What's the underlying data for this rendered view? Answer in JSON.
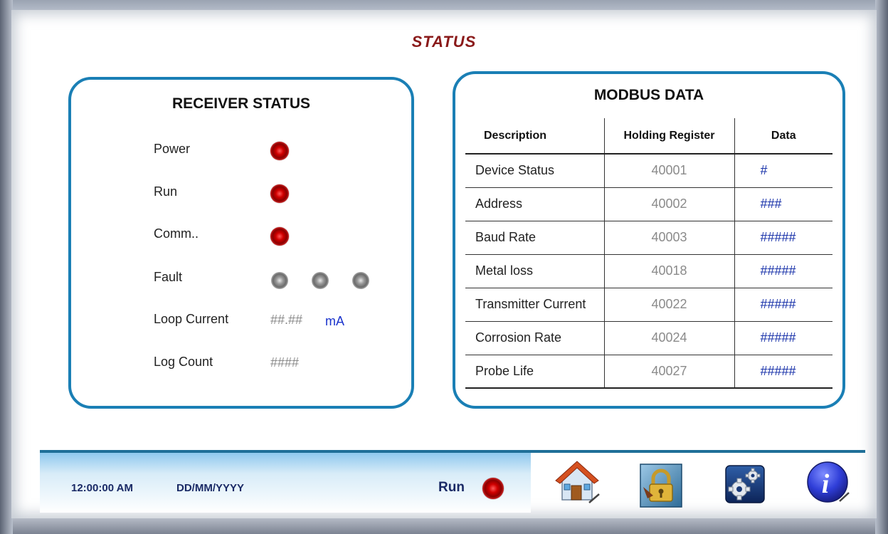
{
  "page_title": "STATUS",
  "receiver_status": {
    "heading": "RECEIVER STATUS",
    "rows": {
      "power": {
        "label": "Power",
        "indicator": "red"
      },
      "run": {
        "label": "Run",
        "indicator": "red"
      },
      "comm": {
        "label": "Comm..",
        "indicator": "red"
      },
      "fault": {
        "label": "Fault",
        "indicators": [
          "grey",
          "grey",
          "grey"
        ]
      },
      "loop_current": {
        "label": "Loop Current",
        "value": "##.##",
        "unit": "mA"
      },
      "log_count": {
        "label": "Log Count",
        "value": "####"
      }
    }
  },
  "modbus": {
    "heading": "MODBUS DATA",
    "columns": [
      "Description",
      "Holding Register",
      "Data"
    ],
    "rows": [
      {
        "description": "Device Status",
        "register": "40001",
        "data": "#"
      },
      {
        "description": "Address",
        "register": "40002",
        "data": "###"
      },
      {
        "description": "Baud Rate",
        "register": "40003",
        "data": "#####"
      },
      {
        "description": "Metal loss",
        "register": "40018",
        "data": "#####"
      },
      {
        "description": "Transmitter Current",
        "register": "40022",
        "data": "#####"
      },
      {
        "description": "Corrosion Rate",
        "register": "40024",
        "data": "#####"
      },
      {
        "description": "Probe Life",
        "register": "40027",
        "data": "#####"
      }
    ]
  },
  "footer": {
    "time": "12:00:00 AM",
    "date": "DD/MM/YYYY",
    "run_label": "Run",
    "run_indicator": "red",
    "buttons": [
      "home-icon",
      "lock-icon",
      "settings-gear-icon",
      "info-icon"
    ]
  },
  "colors": {
    "accent_border": "#1a7fb5",
    "title": "#8a1a1a",
    "led_on": "#d00000",
    "led_off": "#9a9a9a",
    "data_text": "#1a33aa"
  }
}
